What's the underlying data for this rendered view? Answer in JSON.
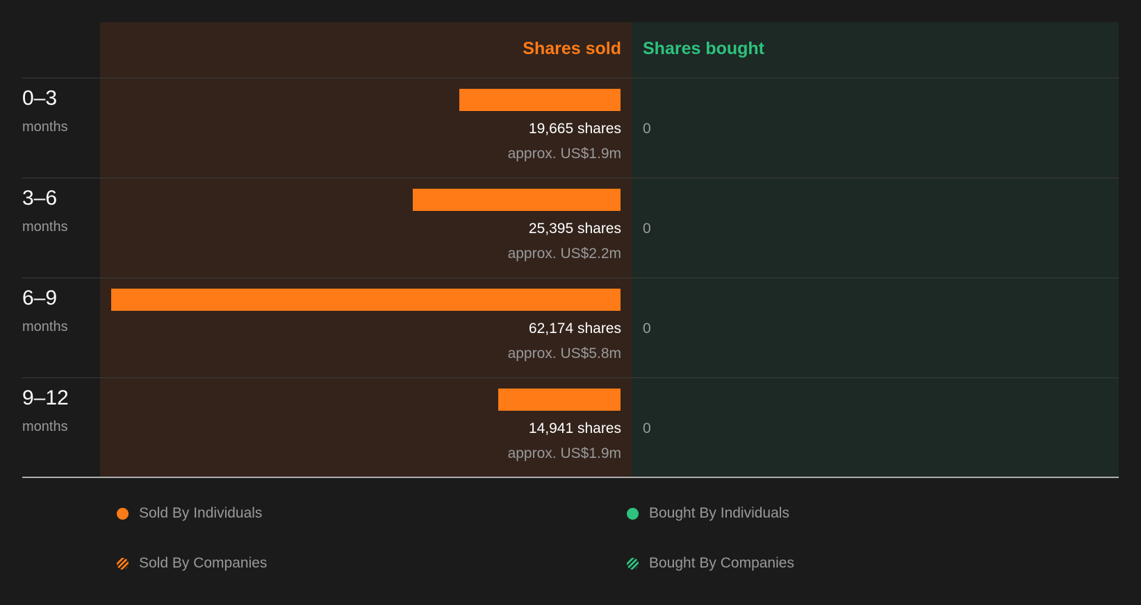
{
  "chart_data": {
    "type": "bar",
    "columns": {
      "sold_label": "Shares sold",
      "bought_label": "Shares bought"
    },
    "categories": [
      {
        "range": "0–3",
        "unit": "months"
      },
      {
        "range": "3–6",
        "unit": "months"
      },
      {
        "range": "6–9",
        "unit": "months"
      },
      {
        "range": "9–12",
        "unit": "months"
      }
    ],
    "series": [
      {
        "name": "Shares sold",
        "values": [
          19665,
          25395,
          62174,
          14941
        ],
        "labels": [
          "19,665 shares",
          "25,395 shares",
          "62,174 shares",
          "14,941 shares"
        ],
        "value_labels": [
          "approx. US$1.9m",
          "approx. US$2.2m",
          "approx. US$5.8m",
          "approx. US$1.9m"
        ]
      },
      {
        "name": "Shares bought",
        "values": [
          0,
          0,
          0,
          0
        ],
        "labels": [
          "0",
          "0",
          "0",
          "0"
        ]
      }
    ],
    "legend": [
      {
        "label": "Sold By Individuals",
        "color": "#ff7b17",
        "pattern": "solid"
      },
      {
        "label": "Bought By Individuals",
        "color": "#2ec27e",
        "pattern": "solid"
      },
      {
        "label": "Sold By Companies",
        "color": "#ff7b17",
        "pattern": "striped"
      },
      {
        "label": "Bought By Companies",
        "color": "#2ec27e",
        "pattern": "striped"
      }
    ],
    "legend_placement": "bottom",
    "colors": {
      "sold": "#ff7b17",
      "bought": "#2ec27e"
    }
  }
}
